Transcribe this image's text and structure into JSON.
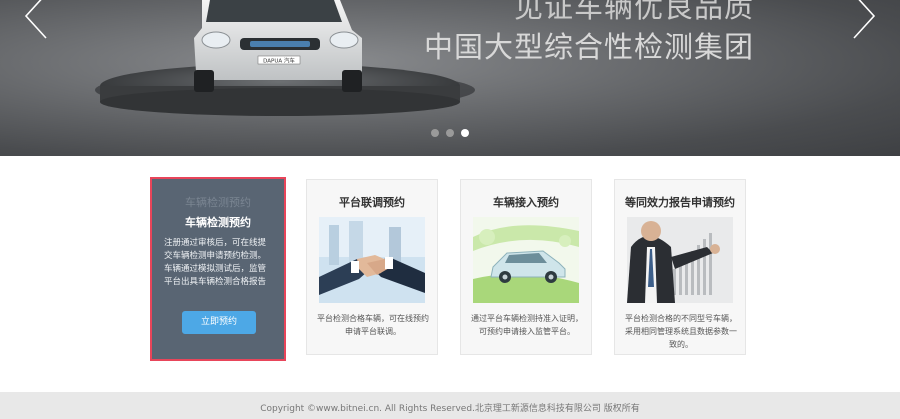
{
  "banner": {
    "slogan_line1": "见证车辆优良品质",
    "slogan_line2": "中国大型综合性检测集团",
    "car_plate": "DAPUA 汽车",
    "dots": [
      false,
      false,
      true
    ]
  },
  "cards": [
    {
      "ghost_title": "车辆检测预约",
      "title": "车辆检测预约",
      "desc": "注册通过审核后，可在线提交车辆检测申请预约检测。车辆通过模拟测试后，监管平台出具车辆检测合格报告",
      "button": "立即预约"
    },
    {
      "title": "平台联调预约",
      "desc": "平台检测合格车辆，可在线预约申请平台联调。",
      "image": "handshake-image"
    },
    {
      "title": "车辆接入预约",
      "desc": "通过平台车辆检测持准入证明，可预约申请接入监管平台。",
      "image": "green-car-image"
    },
    {
      "title": "等同效力报告申请预约",
      "desc": "平台检测合格的不同型号车辆，采用相同管理系统且数据参数一致的。",
      "image": "businessman-chart-image"
    }
  ],
  "footer": {
    "copyright": "Copyright ©www.bitnei.cn. All Rights Reserved.北京理工新源信息科技有限公司 版权所有"
  }
}
